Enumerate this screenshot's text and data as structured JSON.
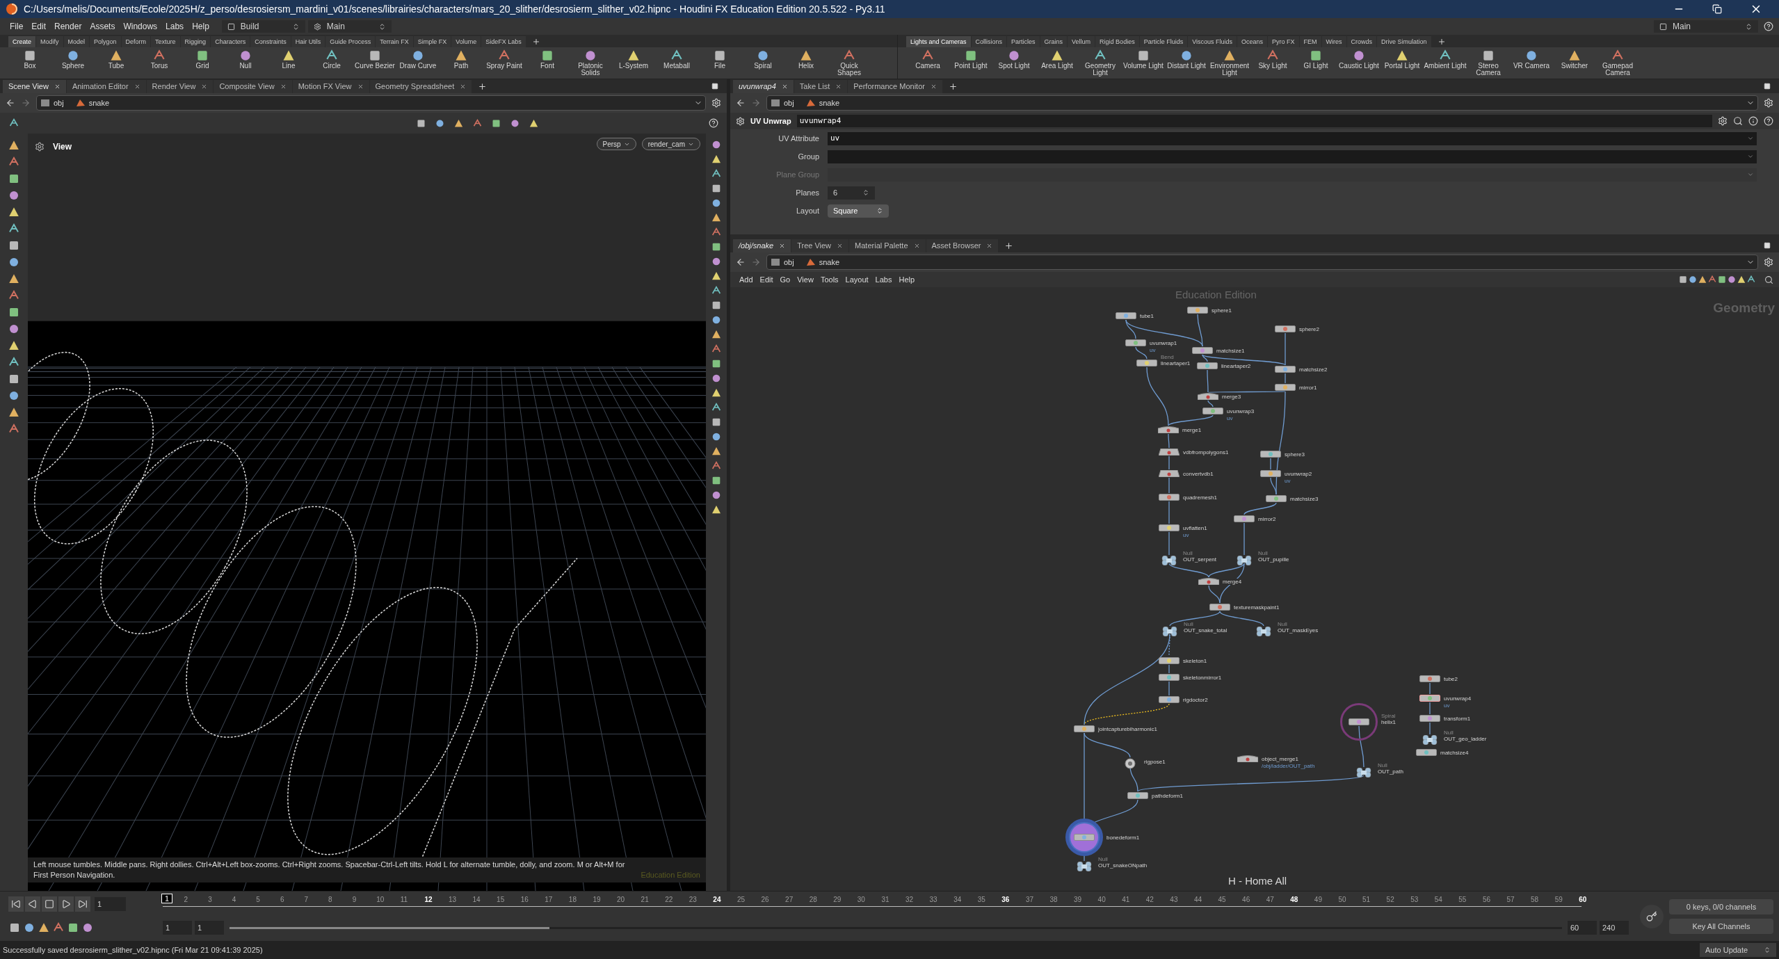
{
  "window": {
    "title": "C:/Users/melis/Documents/Ecole/2025H/z_perso/desrosiersm_mardini_v01/scenes/librairies/characters/mars_20_slither/desrosierm_slither_v02.hipnc - Houdini FX Education Edition 20.5.522 - Py3.11"
  },
  "menu": [
    "File",
    "Edit",
    "Render",
    "Assets",
    "Windows",
    "Labs",
    "Help"
  ],
  "desktop": "Build",
  "context": "Main",
  "right_context": "Main",
  "shelves": [
    {
      "tabs": [
        {
          "label": "Create",
          "selected": true
        },
        {
          "label": "Modify",
          "selected": false
        },
        {
          "label": "Model",
          "selected": false
        },
        {
          "label": "Polygon",
          "selected": false
        },
        {
          "label": "Deform",
          "selected": false
        },
        {
          "label": "Texture",
          "selected": false
        },
        {
          "label": "Rigging",
          "selected": false
        },
        {
          "label": "Characters",
          "selected": false
        },
        {
          "label": "Constraints",
          "selected": false
        },
        {
          "label": "Hair Utils",
          "selected": false
        },
        {
          "label": "Guide Process",
          "selected": false
        },
        {
          "label": "Terrain FX",
          "selected": false
        },
        {
          "label": "Simple FX",
          "selected": false
        },
        {
          "label": "Volume",
          "selected": false
        },
        {
          "label": "SideFX Labs",
          "selected": false
        }
      ],
      "tools": [
        "Box",
        "Sphere",
        "Tube",
        "Torus",
        "Grid",
        "Null",
        "Line",
        "Circle",
        "Curve Bezier",
        "Draw Curve",
        "Path",
        "Spray Paint",
        "Font",
        "Platonic Solids",
        "L-System",
        "Metaball",
        "File",
        "Spiral",
        "Helix",
        "Quick Shapes"
      ]
    },
    {
      "tabs": [
        {
          "label": "Lights and Cameras",
          "selected": true
        },
        {
          "label": "Collisions",
          "selected": false
        },
        {
          "label": "Particles",
          "selected": false
        },
        {
          "label": "Grains",
          "selected": false
        },
        {
          "label": "Vellum",
          "selected": false
        },
        {
          "label": "Rigid Bodies",
          "selected": false
        },
        {
          "label": "Particle Fluids",
          "selected": false
        },
        {
          "label": "Viscous Fluids",
          "selected": false
        },
        {
          "label": "Oceans",
          "selected": false
        },
        {
          "label": "Pyro FX",
          "selected": false
        },
        {
          "label": "FEM",
          "selected": false
        },
        {
          "label": "Wires",
          "selected": false
        },
        {
          "label": "Crowds",
          "selected": false
        },
        {
          "label": "Drive Simulation",
          "selected": false
        }
      ],
      "tools": [
        "Camera",
        "Point Light",
        "Spot Light",
        "Area Light",
        "Geometry Light",
        "Volume Light",
        "Distant Light",
        "Environment Light",
        "Sky Light",
        "GI Light",
        "Caustic Light",
        "Portal Light",
        "Ambient Light",
        "Stereo Camera",
        "VR Camera",
        "Switcher",
        "Gamepad Camera"
      ]
    }
  ],
  "scene_pane": {
    "tabs": [
      {
        "label": "Scene View",
        "selected": true,
        "kind": "pane"
      },
      {
        "label": "Animation Editor",
        "selected": false,
        "kind": "pane"
      },
      {
        "label": "Render View",
        "selected": false,
        "kind": "pane"
      },
      {
        "label": "Composite View",
        "selected": false,
        "kind": "pane"
      },
      {
        "label": "Motion FX View",
        "selected": false,
        "kind": "pane"
      },
      {
        "label": "Geometry Spreadsheet",
        "selected": false,
        "kind": "pane"
      }
    ],
    "path": [
      "obj",
      "snake"
    ],
    "viewport_label": "View",
    "camera_menus": [
      "Persp",
      "render_cam"
    ],
    "hint": "Left mouse tumbles. Middle pans. Right dollies. Ctrl+Alt+Left box-zooms. Ctrl+Right zooms. Spacebar-Ctrl-Left tilts. Hold L for alternate tumble, dolly, and zoom. M or Alt+M for First Person Navigation.",
    "edition_mark": "Education Edition"
  },
  "parameter_pane": {
    "tabs": [
      {
        "label": "uvunwrap4",
        "selected": true,
        "kind": "node"
      },
      {
        "label": "Take List",
        "selected": false,
        "kind": "pane"
      },
      {
        "label": "Performance Monitor",
        "selected": false,
        "kind": "pane"
      }
    ],
    "path": [
      "obj",
      "snake"
    ],
    "node_type": "UV Unwrap",
    "node_name": "uvunwrap4",
    "params": [
      {
        "label": "UV Attribute",
        "kind": "text",
        "value": "uv",
        "disabled": false
      },
      {
        "label": "Group",
        "kind": "text",
        "disabled": false
      },
      {
        "label": "Plane Group",
        "kind": "text",
        "disabled": true
      },
      {
        "label": "Planes",
        "kind": "spinner",
        "value": "6",
        "disabled": false
      },
      {
        "label": "Layout",
        "kind": "menu",
        "value": "Square",
        "disabled": false
      }
    ]
  },
  "network_pane": {
    "tabs": [
      {
        "label": "/obj/snake",
        "selected": true,
        "kind": "node"
      },
      {
        "label": "Tree View",
        "selected": false,
        "kind": "pane"
      },
      {
        "label": "Material Palette",
        "selected": false,
        "kind": "pane"
      },
      {
        "label": "Asset Browser",
        "selected": false,
        "kind": "pane"
      }
    ],
    "path": [
      "obj",
      "snake"
    ],
    "menu": [
      "Add",
      "Edit",
      "Go",
      "View",
      "Tools",
      "Layout",
      "Labs",
      "Help"
    ],
    "edition_mark": "Education Edition",
    "context_label": "Geometry",
    "hint": "H - Home All",
    "nodes": [
      {
        "name": "tube1",
        "kind": "sop",
        "selected": false
      },
      {
        "name": "sphere1",
        "kind": "sop",
        "selected": false
      },
      {
        "name": "sphere2",
        "kind": "sop",
        "selected": false
      },
      {
        "name": "uvunwrap1",
        "kind": "sop",
        "selected": false,
        "sub": "uv"
      },
      {
        "name": "matchsize1",
        "kind": "sop",
        "selected": false
      },
      {
        "name": "lineartaper1",
        "kind": "sop",
        "selected": false,
        "type": "Bend"
      },
      {
        "name": "lineartaper2",
        "kind": "sop",
        "selected": false
      },
      {
        "name": "matchsize2",
        "kind": "sop",
        "selected": false
      },
      {
        "name": "mirror1",
        "kind": "sop",
        "selected": false
      },
      {
        "name": "merge3",
        "kind": "merge",
        "selected": false
      },
      {
        "name": "uvunwrap3",
        "kind": "sop",
        "selected": false,
        "sub": "uv"
      },
      {
        "name": "merge1",
        "kind": "merge",
        "selected": false
      },
      {
        "name": "vdbfrompolygons1",
        "kind": "vdb",
        "selected": false
      },
      {
        "name": "sphere3",
        "kind": "sop",
        "selected": false
      },
      {
        "name": "convertvdb1",
        "kind": "vdb",
        "selected": false
      },
      {
        "name": "uvunwrap2",
        "kind": "sop",
        "selected": false,
        "sub": "uv"
      },
      {
        "name": "quadremesh1",
        "kind": "sop",
        "selected": false
      },
      {
        "name": "matchsize3",
        "kind": "sop",
        "selected": false
      },
      {
        "name": "mirror2",
        "kind": "sop",
        "selected": false
      },
      {
        "name": "uvflatten1",
        "kind": "sop",
        "selected": false,
        "sub": "uv"
      },
      {
        "name": "OUT_serpent",
        "kind": "null",
        "selected": false,
        "type": "Null"
      },
      {
        "name": "OUT_pupille",
        "kind": "null",
        "selected": false,
        "type": "Null"
      },
      {
        "name": "merge4",
        "kind": "merge",
        "selected": false
      },
      {
        "name": "texturemaskpaint1",
        "kind": "sop",
        "selected": false
      },
      {
        "name": "OUT_snake_total",
        "kind": "null",
        "selected": false,
        "type": "Null"
      },
      {
        "name": "OUT_maskEyes",
        "kind": "null",
        "selected": false,
        "type": "Null"
      },
      {
        "name": "skeleton1",
        "kind": "sop",
        "selected": false
      },
      {
        "name": "skeletonmirror1",
        "kind": "sop",
        "selected": false
      },
      {
        "name": "rigdoctor2",
        "kind": "sop",
        "selected": false
      },
      {
        "name": "jointcapturebiharmonic1",
        "kind": "sop",
        "selected": false
      },
      {
        "name": "rigpose1",
        "kind": "round",
        "selected": false
      },
      {
        "name": "object_merge1",
        "kind": "merge",
        "selected": false,
        "sub": "/obj/ladder/OUT_path"
      },
      {
        "name": "helix1",
        "kind": "sop",
        "selected": false,
        "type": "Spiral",
        "ring": true
      },
      {
        "name": "OUT_path",
        "kind": "null",
        "selected": false,
        "type": "Null"
      },
      {
        "name": "pathdeform1",
        "kind": "sop",
        "selected": false
      },
      {
        "name": "bonedeform1",
        "kind": "sop",
        "selected": false,
        "display": true
      },
      {
        "name": "OUT_snakeONpath",
        "kind": "null",
        "selected": false,
        "type": "Null"
      },
      {
        "name": "tube2",
        "kind": "sop",
        "selected": false
      },
      {
        "name": "uvunwrap4",
        "kind": "sop",
        "selected": true,
        "sub": "uv"
      },
      {
        "name": "transform1",
        "kind": "sop",
        "selected": false
      },
      {
        "name": "OUT_geo_ladder",
        "kind": "null",
        "selected": false,
        "type": "Null"
      },
      {
        "name": "matchsize4",
        "kind": "sop",
        "selected": false
      }
    ]
  },
  "timeline": {
    "current_frame": "1",
    "frame_field": "1",
    "ruler_labels": [
      "2",
      "3",
      "4",
      "5",
      "6",
      "7",
      "8",
      "9",
      "10",
      "11",
      "12",
      "13",
      "14",
      "15",
      "16",
      "17",
      "18",
      "19",
      "20",
      "21",
      "22",
      "23",
      "24",
      "25",
      "26",
      "27",
      "28",
      "29",
      "30",
      "31",
      "32",
      "33",
      "34",
      "35",
      "36",
      "37",
      "38",
      "39",
      "40",
      "41",
      "42",
      "43",
      "44",
      "45",
      "46",
      "47",
      "48",
      "49",
      "50",
      "51",
      "52",
      "53",
      "54",
      "55",
      "56",
      "57",
      "58",
      "59",
      "60"
    ],
    "range_slider": {
      "level": 0.24
    },
    "range_start": [
      "1",
      "1"
    ],
    "range_end": [
      "60",
      "240"
    ],
    "keys_info": "0 keys, 0/0 channels",
    "key_mode": "Key All Channels"
  },
  "status_bar": {
    "message": "Successfully saved desrosierm_slither_v02.hipnc (Fri Mar 21 09:41:39 2025)",
    "update_mode": "Auto Update"
  }
}
